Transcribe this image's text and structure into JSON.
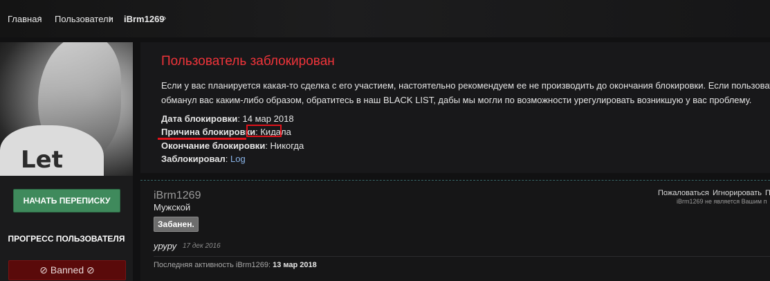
{
  "breadcrumb": {
    "items": [
      "Главная",
      "Пользователи",
      "iBrm1269"
    ],
    "separator": "›"
  },
  "blocked": {
    "title": "Пользователь заблокирован",
    "description_line1": "Если у вас планируется какая-то сделка с его участием, настоятельно рекомендуем ее не производить до окончания блокировки. Если пользователь уже",
    "description_line2": "обманул вас каким-либо образом, обратитесь в наш BLACK LIST, дабы мы могли по возможности урегулировать возникшую у вас проблему.",
    "date_label": "Дата блокировки",
    "date_value": "14 мар 2018",
    "reason_label": "Причина блокировки",
    "reason_value": "Кидала",
    "end_label": "Окончание блокировки",
    "end_value": "Никогда",
    "by_label": "Заблокировал",
    "by_value": "Log"
  },
  "sidebar": {
    "start_conversation": "НАЧАТЬ ПЕРЕПИСКУ",
    "progress_title": "ПРОГРЕСС ПОЛЬЗОВАТЕЛЯ",
    "banned_badge": "⊘ Banned ⊘",
    "avatar_text": "Let"
  },
  "profile": {
    "username": "iBrm1269",
    "gender": "Мужской",
    "ban_badge": "Забанен.",
    "status_text": "уруру",
    "status_date": "17 дек 2016",
    "last_activity_label": "Последняя активность iBrm1269:",
    "last_activity_value": "13 мар 2018",
    "actions": [
      "Пожаловаться",
      "Игнорировать",
      "П"
    ],
    "follow_note": "iBrm1269 не является Вашим п"
  },
  "colors": {
    "accent_red": "#f0343a",
    "start_button": "#3f8a5c",
    "link": "#8ab4e8",
    "banned_bar": "#5a0a0a"
  }
}
